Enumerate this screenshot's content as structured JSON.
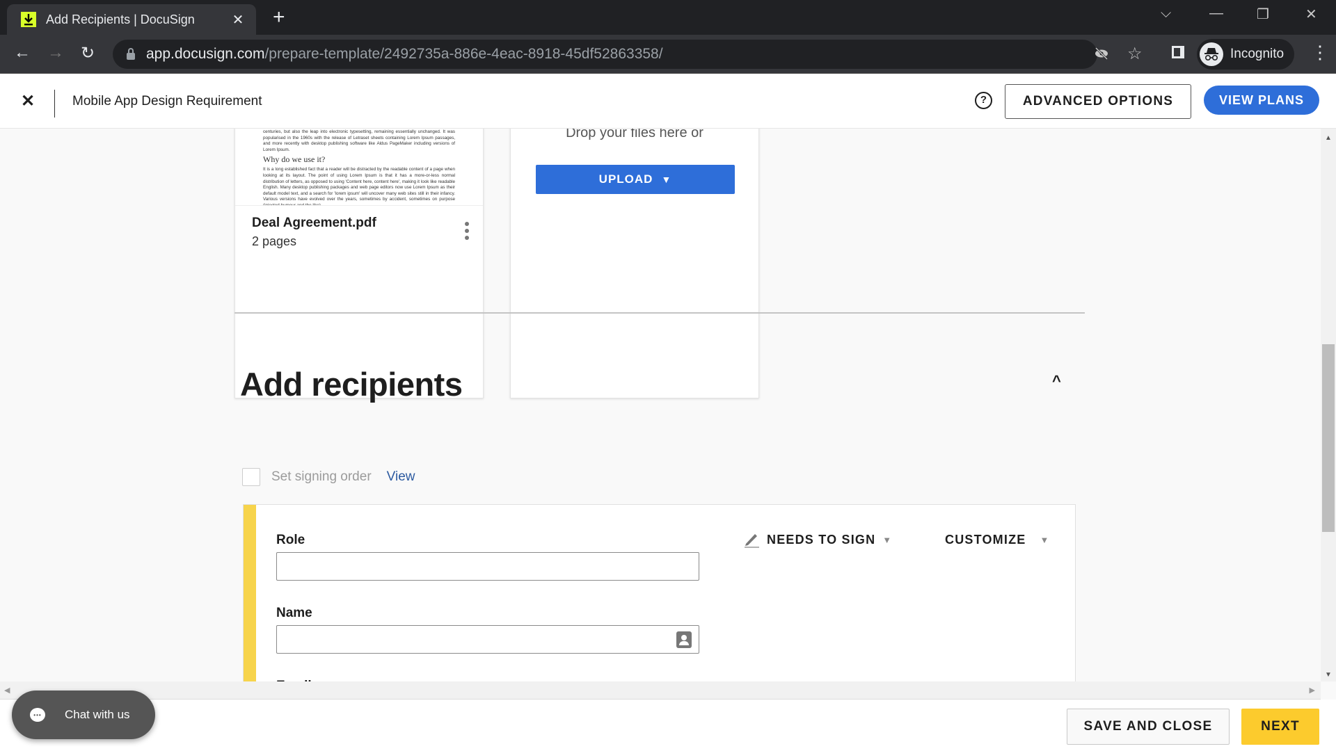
{
  "browser": {
    "tab_title": "Add Recipients | DocuSign",
    "url_host": "app.docusign.com",
    "url_path": "/prepare-template/2492735a-886e-4eac-8918-45df52863358/",
    "profile_label": "Incognito"
  },
  "header": {
    "title": "Mobile App Design Requirement",
    "advanced_options": "ADVANCED OPTIONS",
    "view_plans": "VIEW PLANS",
    "help_glyph": "?"
  },
  "documents": {
    "thumb_text_1": "centuries, but also the leap into electronic typesetting, remaining essentially unchanged. It was popularised in the 1960s with the release of Letraset sheets containing Lorem Ipsum passages, and more recently with desktop publishing software like Aldus PageMaker including versions of Lorem Ipsum.",
    "thumb_heading": "Why do we use it?",
    "thumb_text_2": "It is a long established fact that a reader will be distracted by the readable content of a page when looking at its layout. The point of using Lorem Ipsum is that it has a more-or-less normal distribution of letters, as opposed to using 'Content here, content here', making it look like readable English. Many desktop publishing packages and web page editors now use Lorem Ipsum as their default model text, and a search for 'lorem ipsum' will uncover many web sites still in their infancy. Various versions have evolved over the years, sometimes by accident, sometimes on purpose (injected humour and the like).",
    "file_name": "Deal Agreement.pdf",
    "file_pages": "2 pages",
    "drop_text": "Drop your files here or",
    "upload_label": "UPLOAD"
  },
  "recipients": {
    "title": "Add recipients",
    "signing_order_label": "Set signing order",
    "signing_order_checked": false,
    "view_link": "View",
    "card": {
      "role_label": "Role",
      "role_value": "",
      "name_label": "Name",
      "name_value": "",
      "email_label": "Email",
      "action_label": "NEEDS TO SIGN",
      "customize_label": "CUSTOMIZE",
      "accent_color": "#f7d44c"
    }
  },
  "footer": {
    "save_close": "SAVE AND CLOSE",
    "next": "NEXT"
  },
  "chat": {
    "label": "Chat with us"
  },
  "colors": {
    "primary_blue": "#2e6ed9",
    "next_yellow": "#fccb2d"
  }
}
